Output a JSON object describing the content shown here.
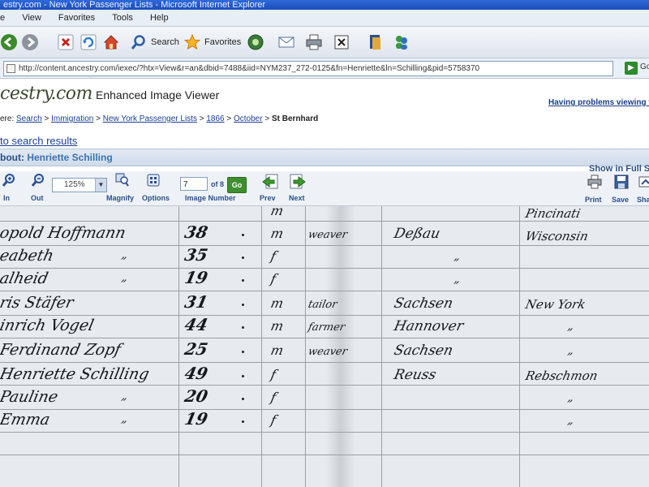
{
  "window": {
    "title": "estry.com - New York Passenger Lists - Microsoft Internet Explorer"
  },
  "menu": [
    "e",
    "View",
    "Favorites",
    "Tools",
    "Help"
  ],
  "toolbar": {
    "search": "Search",
    "favorites": "Favorites"
  },
  "address": {
    "url": "http://content.ancestry.com/iexec/?htx=View&r=an&dbid=7488&iid=NYM237_272-0125&fn=Henriette&ln=Schilling&pid=5758370",
    "go": "Go"
  },
  "site": {
    "logo": "cestry.com",
    "viewer_title": "Enhanced Image Viewer",
    "help": "Having problems viewing th"
  },
  "breadcrumb": {
    "prefix": "ere:",
    "items": [
      "Search",
      "Immigration",
      "New York Passenger Lists",
      "1866",
      "October"
    ],
    "current": "St Bernhard"
  },
  "back_link": "to search results",
  "about": {
    "label": "bout:",
    "name": "Henriette Schilling"
  },
  "full_screen": "Show in Full S",
  "viewer": {
    "in": "In",
    "out": "Out",
    "zoom": "125%",
    "magnify": "Magnify",
    "options": "Options",
    "image_number_value": "7",
    "of_total": "of 8",
    "go": "Go",
    "image_number_label": "Image Number",
    "prev": "Prev",
    "next": "Next",
    "print": "Print",
    "save": "Save",
    "share": "Sha"
  },
  "manifest": {
    "rows": [
      {
        "name": "",
        "age": "",
        "mark": "m",
        "occ": "",
        "place": "",
        "dest": "Pincinati"
      },
      {
        "name": "opold Hoffmann",
        "age": "38",
        "mark": "m",
        "occ": "weaver",
        "place": "Deßau",
        "dest": "Wisconsin"
      },
      {
        "name": "eabeth",
        "age": "35",
        "mark": "f",
        "occ": "",
        "place": "",
        "dest": ""
      },
      {
        "name": "alheid",
        "age": "19",
        "mark": "f",
        "occ": "",
        "place": "",
        "dest": ""
      },
      {
        "name": "ris Stäfer",
        "age": "31",
        "mark": "m",
        "occ": "tailor",
        "place": "Sachsen",
        "dest": "New York"
      },
      {
        "name": "inrich Vogel",
        "age": "44",
        "mark": "m",
        "occ": "farmer",
        "place": "Hannover",
        "dest": ""
      },
      {
        "name": "Ferdinand Zopf",
        "age": "25",
        "mark": "m",
        "occ": "weaver",
        "place": "Sachsen",
        "dest": ""
      },
      {
        "name": "Henriette Schilling",
        "age": "49",
        "mark": "f",
        "occ": "",
        "place": "Reuss",
        "dest": "Rebschmon"
      },
      {
        "name": "Pauline",
        "age": "20",
        "mark": "f",
        "occ": "",
        "place": "",
        "dest": ""
      },
      {
        "name": "Emma",
        "age": "19",
        "mark": "f",
        "occ": "",
        "place": "",
        "dest": ""
      }
    ]
  }
}
